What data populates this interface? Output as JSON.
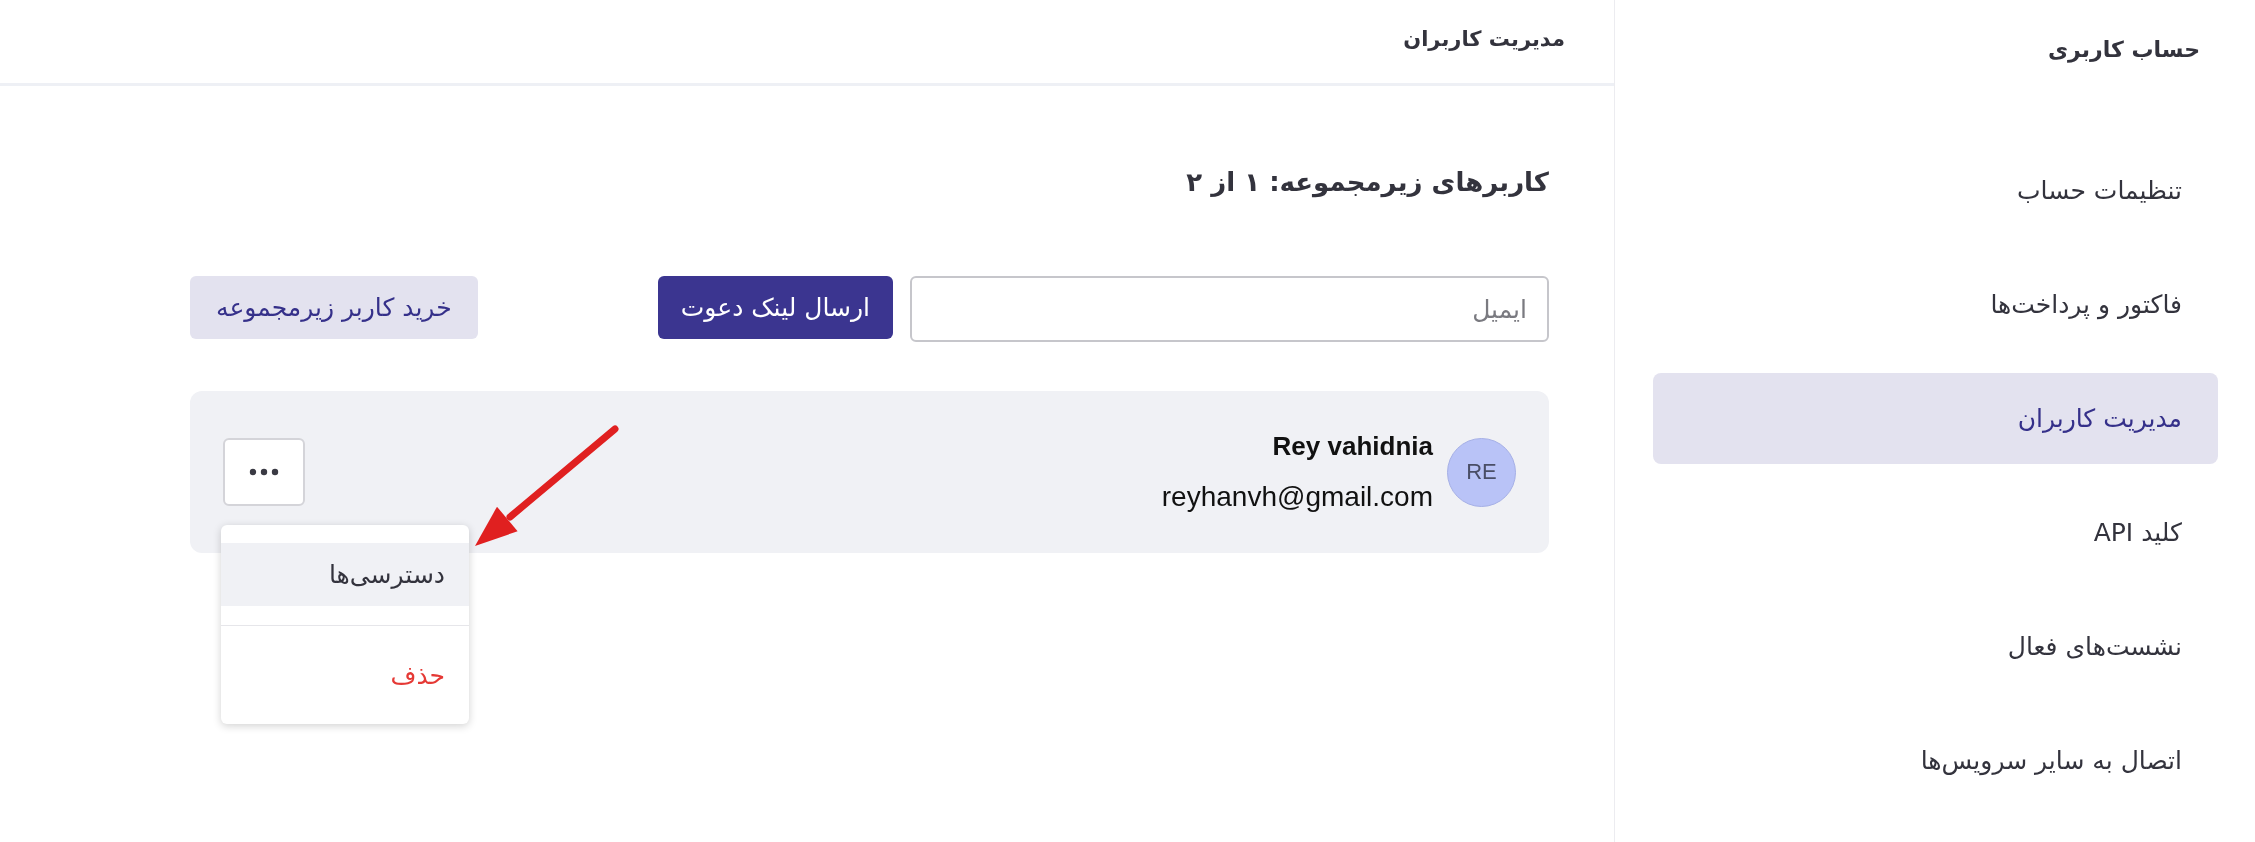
{
  "sidebar": {
    "title": "حساب کاربری",
    "items": [
      {
        "label": "تنظیمات حساب",
        "selected": false
      },
      {
        "label": "فاکتور و پرداخت‌ها",
        "selected": false
      },
      {
        "label": "مدیریت کاربران",
        "selected": true
      },
      {
        "label": "کلید API",
        "selected": false
      },
      {
        "label": "نشست‌های فعال",
        "selected": false
      },
      {
        "label": "اتصال به سایر سرویس‌ها",
        "selected": false
      }
    ]
  },
  "header": {
    "title": "مدیریت کاربران"
  },
  "section": {
    "title": "کاربرهای زیرمجموعه: ۱ از ۲"
  },
  "invite": {
    "placeholder": "ایمیل",
    "send_button": "ارسال لینک دعوت",
    "buy_button": "خرید کاربر زیرمجموعه"
  },
  "users": [
    {
      "initials": "RE",
      "name": "Rey vahidnia",
      "email": "reyhanvh@gmail.com",
      "expanded": true,
      "menu": [
        {
          "label": "دسترسی‌ها",
          "kind": "normal",
          "selected": true
        },
        {
          "label": "حذف",
          "kind": "danger",
          "selected": false
        }
      ]
    }
  ]
}
